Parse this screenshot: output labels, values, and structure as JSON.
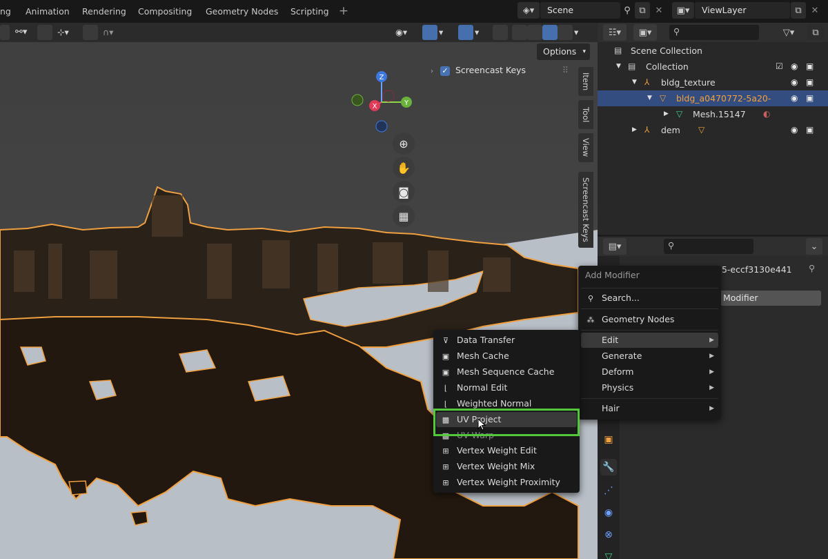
{
  "topbar": {
    "tabs": [
      "ng",
      "Animation",
      "Rendering",
      "Compositing",
      "Geometry Nodes",
      "Scripting"
    ],
    "add_workspace": "+",
    "scene_name": "Scene",
    "view_layer": "ViewLayer"
  },
  "viewport": {
    "options_label": "Options",
    "screencast_panel_label": "Screencast Keys",
    "side_tabs": [
      "Item",
      "Tool",
      "View",
      "Screencast Keys"
    ],
    "gizmo": {
      "z": "Z",
      "y": "Y",
      "x": "X"
    }
  },
  "outliner": {
    "search_placeholder": "",
    "rows": [
      {
        "name": "Scene Collection"
      },
      {
        "name": "Collection"
      },
      {
        "name": "bldg_texture"
      },
      {
        "name": "bldg_a0470772-5a20-"
      },
      {
        "name": "Mesh.15147"
      },
      {
        "name": "dem"
      }
    ]
  },
  "properties": {
    "search_placeholder": "",
    "object_name_partial": ".5-eccf3130e441",
    "add_modifier_partial": "Modifier"
  },
  "add_modifier_menu": {
    "title": "Add Modifier",
    "search": "Search...",
    "items": [
      "Geometry Nodes",
      "Edit",
      "Generate",
      "Deform",
      "Physics",
      "Hair"
    ]
  },
  "edit_submenu": {
    "items": [
      "Data Transfer",
      "Mesh Cache",
      "Mesh Sequence Cache",
      "Normal Edit",
      "Weighted Normal",
      "UV Project",
      "UV Warp",
      "Vertex Weight Edit",
      "Vertex Weight Mix",
      "Vertex Weight Proximity"
    ],
    "highlighted": "UV Project"
  },
  "colors": {
    "accent": "#4772b3",
    "selection_outline": "#f5a13a",
    "highlight_box": "#52c83a",
    "terrain": "#21180f",
    "water": "#b8bec6"
  }
}
